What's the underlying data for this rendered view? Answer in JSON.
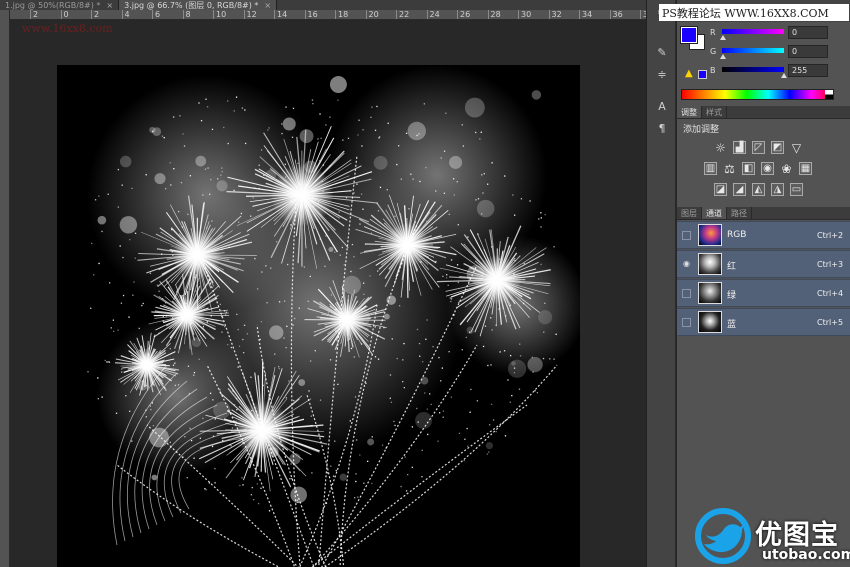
{
  "tabs": [
    {
      "label": "1.jpg @ 50%(RGB/8#) *",
      "active": false
    },
    {
      "label": "3.jpg @ 66.7% (图层 0, RGB/8#) *",
      "active": true
    }
  ],
  "ruler_labels": [
    "2",
    "0",
    "2",
    "4",
    "6",
    "8",
    "10",
    "12",
    "14",
    "16",
    "18",
    "20",
    "22",
    "24",
    "26",
    "28",
    "30",
    "32",
    "34",
    "36",
    "38"
  ],
  "canvas_watermark": "www.16xx8.com",
  "site_banner": "PS教程论坛 WWW.16XX8.COM",
  "color_panel": {
    "channels": [
      {
        "label": "R",
        "value": "0"
      },
      {
        "label": "G",
        "value": "0"
      },
      {
        "label": "B",
        "value": "255"
      }
    ],
    "foreground_color": "#1a00ff",
    "background_color": "#ffffff"
  },
  "adjust_tabs": [
    "调整",
    "样式"
  ],
  "adjust_title": "添加调整",
  "adjust_icons": [
    [
      "brightness-icon",
      "levels-icon",
      "curves-icon",
      "exposure-icon",
      "gradient-triangle-icon"
    ],
    [
      "vibrance-icon",
      "balance-icon",
      "color-balance-icon",
      "photo-filter-icon",
      "channel-mixer-icon",
      "color-lookup-icon"
    ],
    [
      "invert-icon",
      "posterize-icon",
      "threshold-icon",
      "selective-color-icon",
      "gradient-map-icon"
    ]
  ],
  "layer_tabs": [
    "图层",
    "通道",
    "路径"
  ],
  "channels": [
    {
      "name": "RGB",
      "shortcut": "Ctrl+2",
      "visible": false
    },
    {
      "name": "红",
      "shortcut": "Ctrl+3",
      "visible": true
    },
    {
      "name": "绿",
      "shortcut": "Ctrl+4",
      "visible": false
    },
    {
      "name": "蓝",
      "shortcut": "Ctrl+5",
      "visible": false
    }
  ],
  "brand": {
    "name": "优图宝",
    "url": "utobao.com"
  }
}
